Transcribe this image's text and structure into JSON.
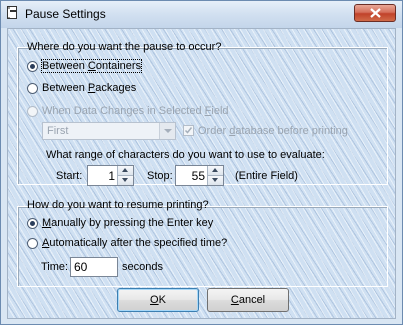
{
  "window": {
    "title": "Pause Settings"
  },
  "pause_group": {
    "legend": "Where do you want the pause to occur?",
    "options": [
      {
        "pre": "Between ",
        "accel": "C",
        "post": "ontainers",
        "checked": true,
        "disabled": false
      },
      {
        "pre": "Between ",
        "accel": "P",
        "post": "ackages",
        "checked": false,
        "disabled": false
      },
      {
        "pre": "When Data Changes in Selected ",
        "accel": "F",
        "post": "ield",
        "checked": false,
        "disabled": true
      }
    ],
    "field_select_value": "First",
    "order_checkbox": {
      "pre": "Order ",
      "accel": "d",
      "post": "atabase before printing",
      "checked": true
    },
    "range_prompt": "What range of characters do you want to use to evaluate:",
    "start_label": "Start:",
    "start_value": "1",
    "stop_label": "Stop:",
    "stop_value": "55",
    "entire_field_note": "(Entire Field)"
  },
  "resume_group": {
    "legend": "How do you want to resume printing?",
    "options": [
      {
        "pre": "",
        "accel": "M",
        "post": "anually by pressing the Enter key",
        "checked": true
      },
      {
        "pre": "",
        "accel": "A",
        "post": "utomatically after the specified time?",
        "checked": false
      }
    ],
    "time_label": "Time:",
    "time_value": "60",
    "time_unit": "seconds"
  },
  "buttons": {
    "ok": {
      "accel": "O",
      "post": "K"
    },
    "cancel": {
      "accel": "C",
      "post": "ancel"
    }
  },
  "icons": {
    "app": "app-icon",
    "close": "close-icon"
  },
  "colors": {
    "close_button": "#c1422a",
    "background": "#cfe0f2"
  }
}
